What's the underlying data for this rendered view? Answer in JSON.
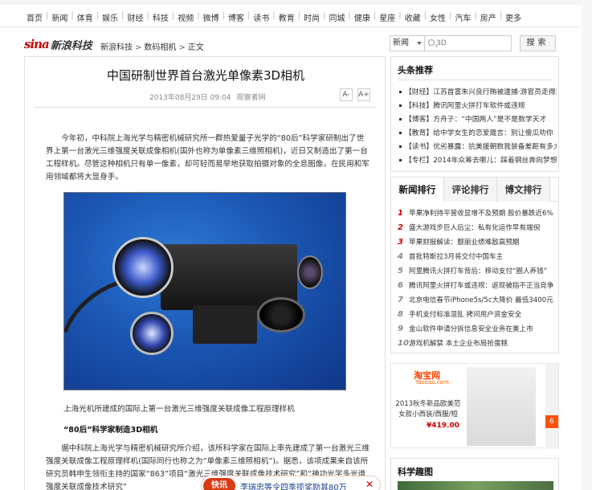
{
  "nav": {
    "items": [
      "首页",
      "新闻",
      "体育",
      "娱乐",
      "财经",
      "科技",
      "视频",
      "微博",
      "博客",
      "读书",
      "教育",
      "时尚",
      "同城",
      "健康",
      "星座",
      "收藏",
      "女性",
      "汽车",
      "房产"
    ],
    "more": "更多"
  },
  "header": {
    "logo_brand": "sina",
    "logo_channel": "新浪科技",
    "breadcrumb": [
      "新浪科技",
      "数码相机",
      "正文"
    ]
  },
  "search": {
    "category": "新闻",
    "placeholder": "3D",
    "button": "搜索"
  },
  "article": {
    "title": "中国研制世界首台激光单像素3D相机",
    "date": "2013年08月29日 09:04",
    "source": "观察者网",
    "font_smaller": "A-",
    "font_larger": "A+",
    "para1": "今年初，中科院上海光学与精密机械研究所一群热爱量子光学的“80后”科学家研制出了世界上第一台激光三维强度关联成像相机(国外也称为单像素三维照相机)，近日又制造出了第一台工程样机。尽管这种相机只有单一像素，却可轻而易举地获取拍摄对象的全息图像，在民用和军用领域都将大显身手。",
    "caption": "上海光机所建成的国际上第一台激光三维强度关联成像工程原理样机",
    "subhead": "“80后”科学家制造3D相机",
    "para2": "据中科院上海光学与精密机械研究所介绍，该所科学家在国际上率先建成了第一台激光三维强度关联成像工程原理样机(国际同行也称之为“单像素三维照相机”)。据悉，该项成果来自该所研究员韩申生领衔主持的国家“863”项目“激光三维强度关联成像技术研究”和“神功光学多光谱强度关联成像技术研究”"
  },
  "ad": {
    "badge": "快讯",
    "text": "李瑞忠等令四季揽奖励其80万"
  },
  "headlines": {
    "title": "头条推荐",
    "items": [
      "【财经】江苏首富朱兴良行贿被逮捕·游官员走得近",
      "【科技】腾讯阿里火拼打车软件或违规",
      "【博客】方舟子：“中国两人”是不是数学天才",
      "【教育】给中学女生的恋爱箴言：别让傻瓜劝你",
      "【读书】优劣暴露：抗美援朝数我装备差距有多大",
      "【专栏】2014年众筹去哪儿：踩着钢丝奔向梦想"
    ]
  },
  "ranking": {
    "tabs": [
      "新闻排行",
      "评论排行",
      "博文排行"
    ],
    "items": [
      "苹果净利持平营收显增不及预期 股价暴跌近6%",
      "盛大游戏步巨人后尘：私有化运作早有端倪",
      "苹果财报解读：靓丽业绩难敌高预期",
      "首批特斯拉3月将交付中国车主",
      "阿里腾讯火拼打车背后：移动支付“圈人养钱”",
      "腾讯阿里火拼打车或违规：返现被指不正当竞争",
      "北京电信春节iPhone5s/5c大降价 最低3400元",
      "手机支付标准混乱 拷问用户资金安全",
      "金山软件申请分拆信息安全业务在美上市",
      "游戏机解禁 本土企业布局抢蛋糕"
    ],
    "numbers": [
      "1",
      "2",
      "3",
      "4",
      "5",
      "6",
      "7",
      "8",
      "9",
      "10"
    ]
  },
  "taobao": {
    "logo": "淘宝网",
    "logo_sub": "Taobao.com",
    "product": "2013秋冬新品欧美范女款小西装/西服/短",
    "price": "¥419.00",
    "page_num": "6"
  },
  "science": {
    "title": "科学趣图"
  }
}
